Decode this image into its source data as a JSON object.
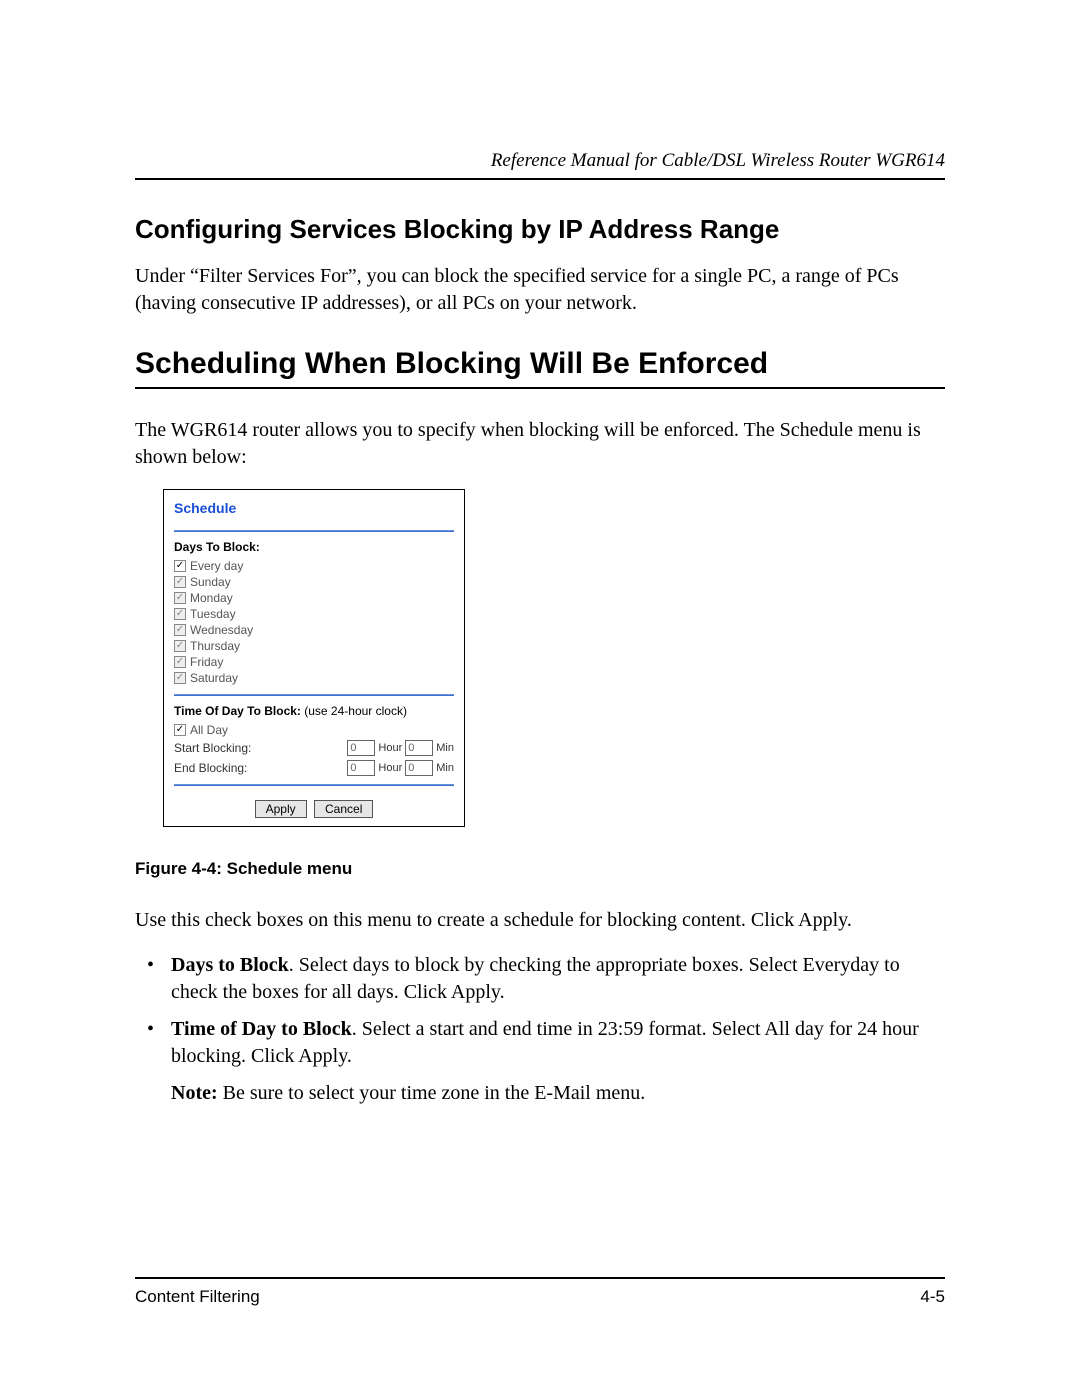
{
  "header": {
    "running_title": "Reference Manual for Cable/DSL Wireless Router WGR614"
  },
  "section1": {
    "title": "Configuring Services Blocking by IP Address Range",
    "para": "Under “Filter Services For”, you can block the specified service for a single PC, a range of PCs (having consecutive IP addresses), or all PCs on your network."
  },
  "section2": {
    "title": "Scheduling When Blocking Will Be Enforced",
    "intro": "The WGR614 router allows you to specify when blocking will be enforced. The Schedule menu is shown below:"
  },
  "schedule_panel": {
    "title": "Schedule",
    "days_label": "Days To Block:",
    "days": [
      {
        "label": "Every day",
        "checked": true,
        "enabled": true
      },
      {
        "label": "Sunday",
        "checked": true,
        "enabled": false
      },
      {
        "label": "Monday",
        "checked": true,
        "enabled": false
      },
      {
        "label": "Tuesday",
        "checked": true,
        "enabled": false
      },
      {
        "label": "Wednesday",
        "checked": true,
        "enabled": false
      },
      {
        "label": "Thursday",
        "checked": true,
        "enabled": false
      },
      {
        "label": "Friday",
        "checked": true,
        "enabled": false
      },
      {
        "label": "Saturday",
        "checked": true,
        "enabled": false
      }
    ],
    "time_label_bold": "Time Of Day To Block:",
    "time_label_hint": " (use 24-hour clock)",
    "all_day": {
      "label": "All Day",
      "checked": true
    },
    "start_label": "Start Blocking:",
    "end_label": "End Blocking:",
    "hour_unit": "Hour",
    "min_unit": "Min",
    "start_hour": "0",
    "start_min": "0",
    "end_hour": "0",
    "end_min": "0",
    "apply": "Apply",
    "cancel": "Cancel"
  },
  "figure_caption": "Figure 4-4:  Schedule menu",
  "usage_para": "Use this check boxes on this menu to create a schedule for blocking content. Click Apply.",
  "bullets": {
    "b1_bold": "Days to Block",
    "b1_rest": ". Select days to block by checking the appropriate boxes. Select Everyday to check the boxes for all days. Click Apply.",
    "b2_bold": "Time of Day to Block",
    "b2_rest": ". Select a start and end time in 23:59 format. Select All day for 24 hour blocking. Click Apply."
  },
  "note_bold": "Note:",
  "note_rest": " Be sure to select your time zone in the E-Mail menu.",
  "footer": {
    "left": "Content Filtering",
    "right": "4-5"
  }
}
